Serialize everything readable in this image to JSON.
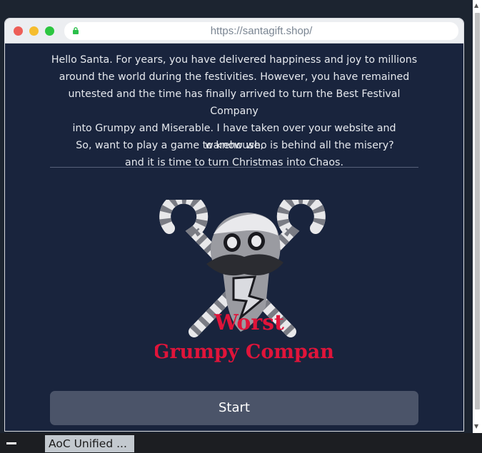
{
  "browser": {
    "url": "https://santagift.shop/"
  },
  "page": {
    "intro_lines": [
      "Hello Santa. For years, you have delivered happiness and joy to millions",
      "around the world during the festivities. However, you have remained",
      "untested and the time has finally arrived to turn the Best Festival Company",
      "into Grumpy and Miserable. I have taken over your website and warehouse,",
      "and it is time to turn Christmas into Chaos."
    ],
    "question": "So, want to play a game to know who is behind all the misery?",
    "logo": {
      "line1": "Worst",
      "line2": "Grumpy Company",
      "text_color": "#e0143a"
    },
    "start_label": "Start"
  },
  "taskbar": {
    "task_label": "AoC Unified ..."
  },
  "colors": {
    "page_background": "#19243d",
    "button_background": "#4b5469",
    "logo_red": "#e0143a"
  }
}
